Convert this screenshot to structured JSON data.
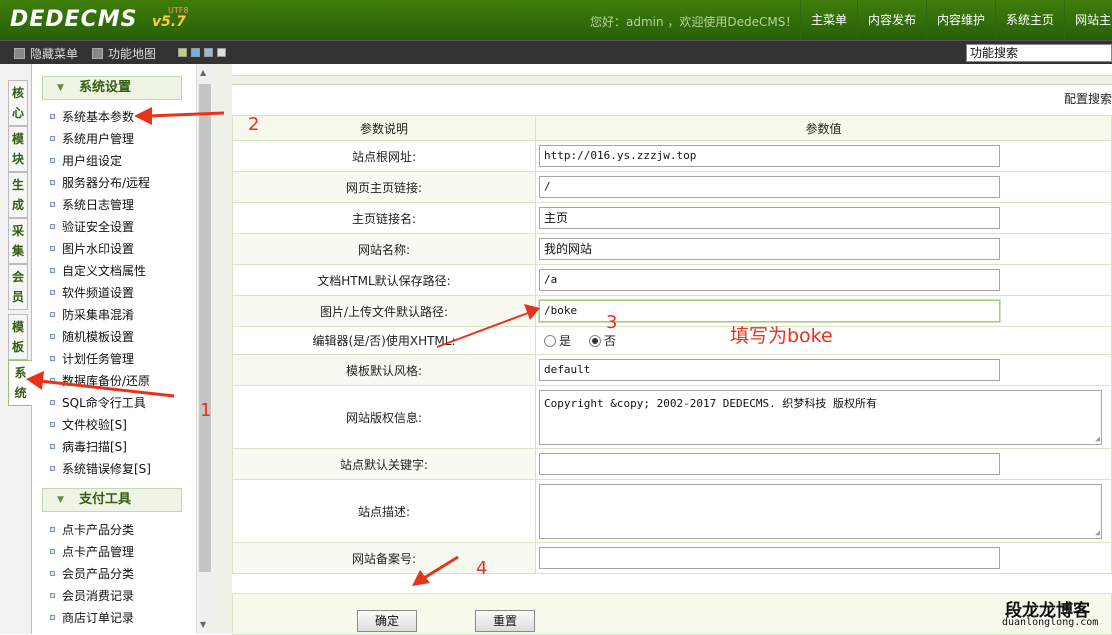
{
  "header": {
    "logo_text": "DEDECMS",
    "version": "v5.7",
    "utf_tag": "UTF8",
    "welcome": "您好：admin ，欢迎使用DedeCMS！",
    "nav": [
      "主菜单",
      "内容发布",
      "内容维护",
      "系统主页",
      "网站主"
    ]
  },
  "toolbar": {
    "hide_menu": "隐藏菜单",
    "function_map": "功能地图",
    "swatches": [
      "#b8d86a",
      "#6fb2e8",
      "#9bb9d8",
      "#dddddd"
    ],
    "search_value": "功能搜索"
  },
  "side_tabs": [
    "核心",
    "模块",
    "生成",
    "采集",
    "会员",
    "模板",
    "系统"
  ],
  "menu": {
    "group1": {
      "title": "系统设置",
      "items": [
        "系统基本参数",
        "系统用户管理",
        "用户组设定",
        "服务器分布/远程",
        "系统日志管理",
        "验证安全设置",
        "图片水印设置",
        "自定义文档属性",
        "软件频道设置",
        "防采集串混淆",
        "随机模板设置",
        "计划任务管理",
        "数据库备份/还原",
        "SQL命令行工具",
        "文件校验[S]",
        "病毒扫描[S]",
        "系统错误修复[S]"
      ]
    },
    "group2": {
      "title": "支付工具",
      "items": [
        "点卡产品分类",
        "点卡产品管理",
        "会员产品分类",
        "会员消费记录",
        "商店订单记录"
      ]
    }
  },
  "main": {
    "config_search": "配置搜索",
    "col_param": "参数说明",
    "col_value": "参数值",
    "rows": [
      {
        "label": "站点根网址:",
        "value": "http://016.ys.zzzjw.top"
      },
      {
        "label": "网页主页链接:",
        "value": "/"
      },
      {
        "label": "主页链接名:",
        "value": "主页"
      },
      {
        "label": "网站名称:",
        "value": "我的网站"
      },
      {
        "label": "文档HTML默认保存路径:",
        "value": "/a"
      },
      {
        "label": "图片/上传文件默认路径:",
        "value": "/boke"
      },
      {
        "label": "编辑器(是/否)使用XHTML:",
        "yes": "是",
        "no": "否"
      },
      {
        "label": "模板默认风格:",
        "value": "default"
      },
      {
        "label": "网站版权信息:",
        "value": "Copyright &copy; 2002-2017 DEDECMS. 织梦科技 版权所有"
      },
      {
        "label": "站点默认关键字:",
        "value": ""
      },
      {
        "label": "站点描述:",
        "value": ""
      },
      {
        "label": "网站备案号:",
        "value": ""
      }
    ],
    "ok_button": "确定",
    "reset_button": "重置"
  },
  "annotations": {
    "n1": "1",
    "n2": "2",
    "n3": "3",
    "n4": "4",
    "fill_note": "填写为boke",
    "color": "#e8331a"
  },
  "watermark": {
    "title": "段龙龙博客",
    "url": "duanlonglong.com"
  }
}
